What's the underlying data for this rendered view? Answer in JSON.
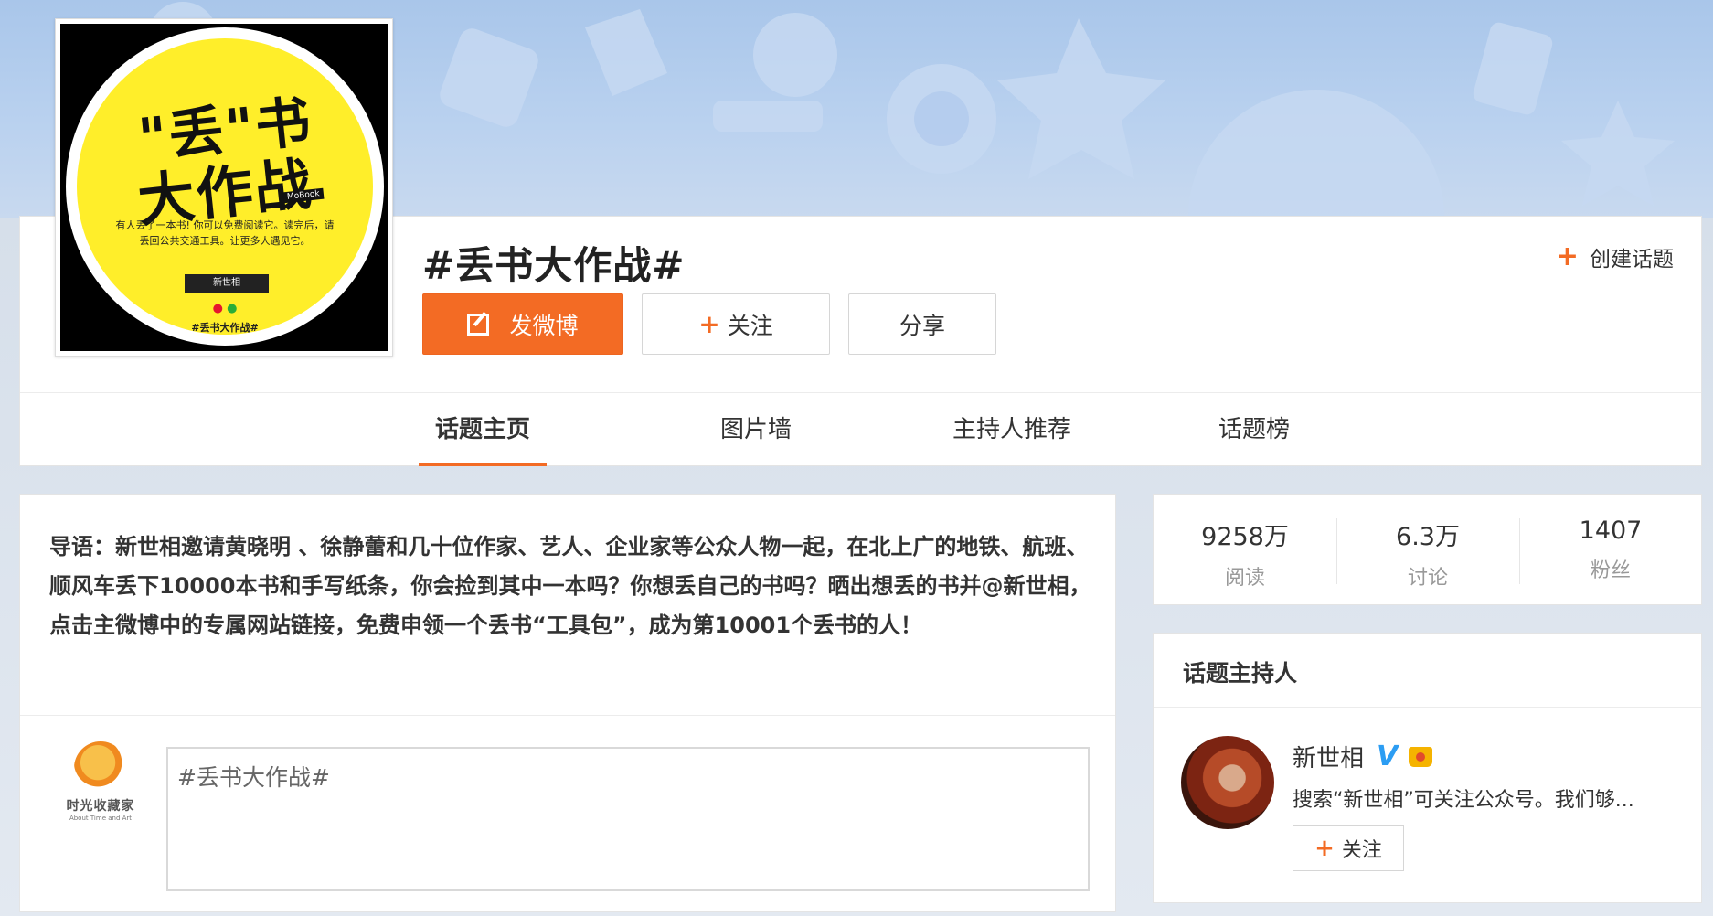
{
  "cover": {
    "title_line1": "\"丢\"书",
    "title_line2": "大作战",
    "tag": "MoBook",
    "text": "有人丢了一本书! 你可以免费阅读它。读完后，请丢回公共交通工具。让更多人遇见它。",
    "box": "新世相",
    "hashtag": "#丢书大作战#"
  },
  "header": {
    "title": "#丢书大作战#",
    "post_button": "发微博",
    "follow_button": "关注",
    "share_button": "分享",
    "create_topic": "创建话题"
  },
  "tabs": [
    {
      "label": "话题主页",
      "active": true
    },
    {
      "label": "图片墙",
      "active": false
    },
    {
      "label": "主持人推荐",
      "active": false
    },
    {
      "label": "话题榜",
      "active": false
    }
  ],
  "intro": {
    "text": "导语：新世相邀请黄晓明 、徐静蕾和几十位作家、艺人、企业家等公众人物一起，在北上广的地铁、航班、顺风车丢下10000本书和手写纸条，你会捡到其中一本吗？你想丢自己的书吗？晒出想丢的书并@新世相，点击主微博中的专属网站链接，免费申领一个丢书“工具包”，成为第10001个丢书的人！"
  },
  "poster": {
    "logo_text": "时光收藏家",
    "logo_sub": "About Time and Art"
  },
  "composer": {
    "value": "#丢书大作战#"
  },
  "stats": [
    {
      "value": "9258万",
      "label": "阅读"
    },
    {
      "value": "6.3万",
      "label": "讨论"
    },
    {
      "value": "1407",
      "label": "粉丝"
    }
  ],
  "host": {
    "section_title": "话题主持人",
    "name": "新世相",
    "verified_mark": "V",
    "description": "搜索“新世相”可关注公众号。我们够...",
    "follow_button": "关注"
  },
  "colors": {
    "accent": "#f36b24",
    "verified": "#2c9df3",
    "cover_yellow": "#ffee2a"
  }
}
